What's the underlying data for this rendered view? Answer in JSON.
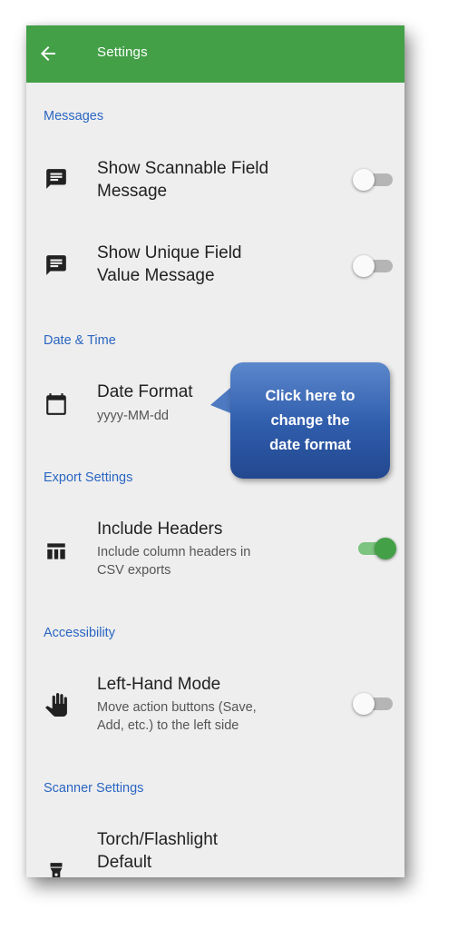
{
  "appbar": {
    "title": "Settings",
    "back_icon": "arrow-left-icon"
  },
  "sections": {
    "messages": "Messages",
    "date_time": "Date & Time",
    "export": "Export Settings",
    "accessibility": "Accessibility",
    "scanner": "Scanner Settings"
  },
  "rows": {
    "scannable": {
      "title_line1": "Show Scannable Field",
      "title_line2": "Message",
      "icon": "message-icon",
      "enabled": false
    },
    "unique": {
      "title_line1": "Show Unique Field",
      "title_line2": "Value Message",
      "icon": "message-icon",
      "enabled": false
    },
    "date_format": {
      "title": "Date Format",
      "value": "yyyy-MM-dd",
      "icon": "calendar-icon"
    },
    "include_headers": {
      "title": "Include Headers",
      "sub_line1": "Include column headers in",
      "sub_line2": "CSV exports",
      "icon": "table-icon",
      "enabled": true
    },
    "left_hand": {
      "title": "Left-Hand Mode",
      "sub_line1": "Move action buttons (Save,",
      "sub_line2": "Add, etc.) to the left side",
      "icon": "hand-icon",
      "enabled": false
    },
    "torch": {
      "title_line1": "Torch/Flashlight",
      "title_line2": "Default",
      "icon": "flashlight-icon",
      "enabled": false
    }
  },
  "callout": {
    "line1": "Click here to",
    "line2": "change the",
    "line3": "date format"
  },
  "colors": {
    "appbar": "#43a047",
    "section_header": "#2a66c2",
    "callout": "#2f5cab"
  }
}
